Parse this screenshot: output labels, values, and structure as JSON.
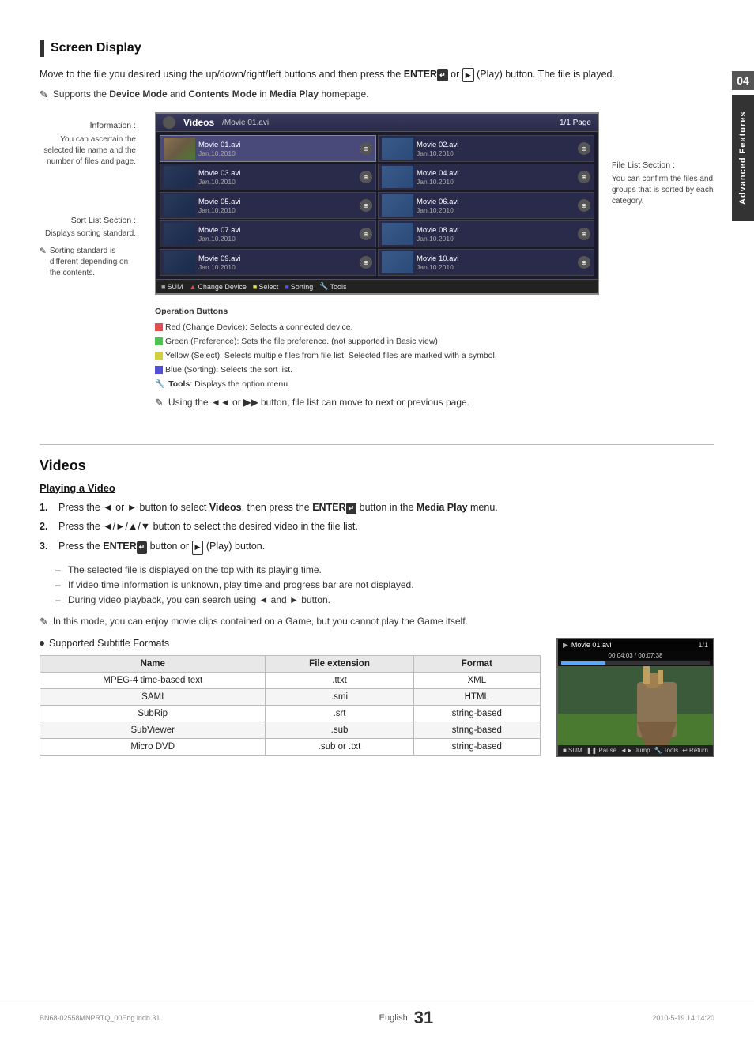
{
  "page": {
    "title": "Screen Display",
    "side_tab": "Advanced Features",
    "side_tab_number": "04",
    "page_number": "31",
    "english_label": "English",
    "footer_file": "BN68-02558MNPRTQ_00Eng.indb   31",
    "footer_date": "2010-5-19   14:14:20"
  },
  "screen_display": {
    "intro": "Move to the file you desired using the up/down/right/left buttons and then press the ENTER or  (Play) button. The file is played.",
    "note": "Supports the Device Mode and Contents Mode in Media Play homepage.",
    "info_label": "Information :",
    "info_desc": "You can ascertain the selected file name and the number of files and page.",
    "sort_label": "Sort List Section :",
    "sort_desc": "Displays sorting standard.",
    "sort_note": "Sorting standard is different depending on the contents.",
    "file_list_label": "File List Section :",
    "file_list_desc": "You can confirm the files and groups that is sorted by each category.",
    "op_title": "Operation Buttons",
    "op_red": "Red (Change Device): Selects a connected device.",
    "op_green": "Green (Preference): Sets the file preference. (not supported in Basic view)",
    "op_yellow": "Yellow (Select): Selects multiple files from file list. Selected files are marked with a symbol.",
    "op_blue": "Blue (Sorting): Selects the sort list.",
    "op_tools": "Tools: Displays the option menu.",
    "op_note": "Using the  or  button, file list can move to next or previous page.",
    "browser": {
      "title": "Videos",
      "path": "/Movie 01.avi",
      "page": "1/1 Page",
      "items": [
        {
          "name": "Movie 01.avi",
          "date": "Jan.10.2010"
        },
        {
          "name": "Movie 02.avi",
          "date": "Jan.10.2010"
        },
        {
          "name": "Movie 03.avi",
          "date": "Jan.10.2010"
        },
        {
          "name": "Movie 04.avi",
          "date": "Jan.10.2010"
        },
        {
          "name": "Movie 05.avi",
          "date": "Jan.10.2010"
        },
        {
          "name": "Movie 06.avi",
          "date": "Jan.10.2010"
        },
        {
          "name": "Movie 07.avi",
          "date": "Jan.10.2010"
        },
        {
          "name": "Movie 08.avi",
          "date": "Jan.10.2010"
        },
        {
          "name": "Movie 09.avi",
          "date": "Jan.10.2010"
        },
        {
          "name": "Movie 10.avi",
          "date": "Jan.10.2010"
        }
      ],
      "footer": {
        "sum": "SUM",
        "change_device": "Change Device",
        "select": "Select",
        "sorting": "Sorting",
        "tools": "Tools"
      }
    }
  },
  "videos": {
    "heading": "Videos",
    "subheading": "Playing a Video",
    "steps": [
      "Press the ◄ or ► button to select Videos, then press the ENTER button in the Media Play menu.",
      "Press the ◄/►/▲/▼ button to select the desired video in the file list.",
      "Press the ENTER button or  (Play) button."
    ],
    "bullets": [
      "The selected file is displayed on the top with its playing time.",
      "If video time information is unknown, play time and progress bar are not displayed.",
      "During video playback, you can search using ◄ and ► button."
    ],
    "note": "In this mode, you can enjoy movie clips contained on a Game, but you cannot play the Game itself.",
    "subtitle_section": "Supported Subtitle Formats",
    "table": {
      "headers": [
        "Name",
        "File extension",
        "Format"
      ],
      "rows": [
        [
          "MPEG-4 time-based text",
          ".ttxt",
          "XML"
        ],
        [
          "SAMI",
          ".smi",
          "HTML"
        ],
        [
          "SubRip",
          ".srt",
          "string-based"
        ],
        [
          "SubViewer",
          ".sub",
          "string-based"
        ],
        [
          "Micro DVD",
          ".sub or .txt",
          "string-based"
        ]
      ]
    },
    "playback": {
      "filename": "Movie 01.avi",
      "time": "00:04:03 / 00:07:38",
      "page": "1/1",
      "footer_items": [
        "SUM",
        "Pause",
        "Jump",
        "Tools",
        "Return"
      ]
    }
  }
}
